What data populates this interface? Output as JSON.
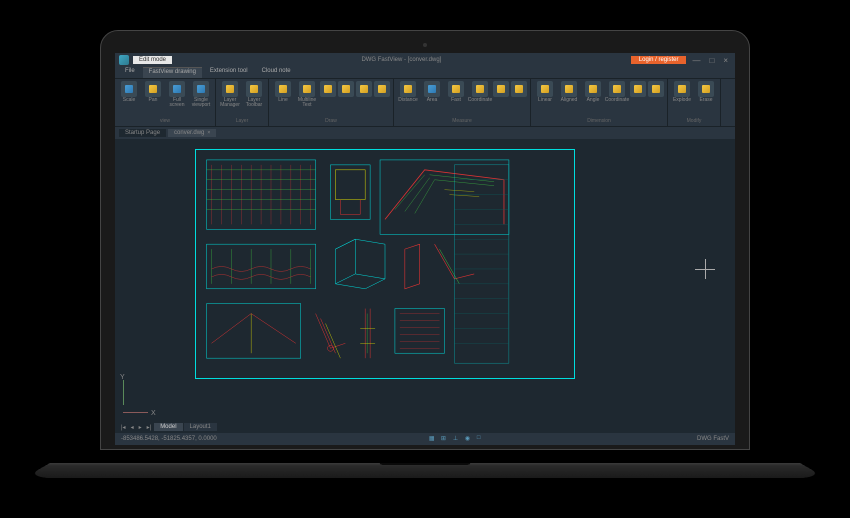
{
  "titlebar": {
    "edit_mode": "Edit mode",
    "title": "DWG FastView - [conver.dwg]",
    "login": "Login / register"
  },
  "menu": {
    "file": "File",
    "fastview": "FastView drawing",
    "extension": "Extension tool",
    "cloud": "Cloud note"
  },
  "ribbon": {
    "view": {
      "label": "view",
      "scale": "Scale",
      "pan": "Pan",
      "full": "Full screen",
      "single": "Single viewport"
    },
    "layer": {
      "label": "Layer",
      "manager": "Layer Manager",
      "toolbar": "Layer Toolbar"
    },
    "draw": {
      "label": "Draw",
      "line": "Line",
      "multiline": "Multiline Text"
    },
    "measure": {
      "label": "Measure",
      "distance": "Distance",
      "area": "Area",
      "fast": "Fast",
      "coordinate": "Coordinate"
    },
    "dimension": {
      "label": "Dimension",
      "linear": "Linear",
      "aligned": "Aligned",
      "angle": "Angle",
      "coordinate": "Coordinate"
    },
    "modify": {
      "label": "Modify",
      "explode": "Explode",
      "erase": "Erase"
    }
  },
  "tabs": {
    "startup": "Startup Page",
    "file": "conver.dwg"
  },
  "axis": {
    "x": "X",
    "y": "Y"
  },
  "layout": {
    "model": "Model",
    "layout1": "Layout1"
  },
  "statusbar": {
    "coords": "-853486.5428, -51825.4357, 0.0000",
    "app": "DWG FastV"
  }
}
